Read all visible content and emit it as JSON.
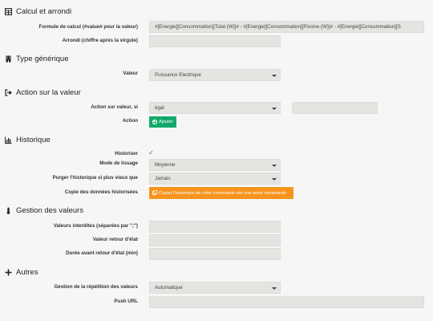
{
  "sections": {
    "calcul": "Calcul et arrondi",
    "type": "Type générique",
    "action": "Action sur la valeur",
    "historique": "Historique",
    "gestion": "Gestion des valeurs",
    "autres": "Autres"
  },
  "calcul": {
    "formula_label": "Formule de calcul (#value# pour la valeur)",
    "formula_value": "#[Energie][Consommation][Total (W)]# - #[Energie][Consommation][Piscine (W)]# - #[Energie][Consommation][S",
    "round_label": "Arrondi (chiffre après la virgule)",
    "round_value": ""
  },
  "type": {
    "valeur_label": "Valeur",
    "valeur_selected": "Puissance Electrique"
  },
  "action": {
    "condition_label": "Action sur valeur, si",
    "condition_selected": "égal",
    "condition_value": "",
    "action_label": "Action",
    "add_button": "Ajouter"
  },
  "historique": {
    "historiser_label": "Historiser",
    "historiser_checked": "✓",
    "lissage_label": "Mode de lissage",
    "lissage_selected": "Moyenne",
    "purge_label": "Purger l'historique si plus vieux que",
    "purge_selected": "Jamais",
    "copy_label": "Copie des données historisées",
    "copy_button": "Copier l'historique de cette commande sur une autre commande"
  },
  "gestion": {
    "interdites_label": "Valeurs interdites (séparées par \";\")",
    "interdites_value": "",
    "retour_label": "Valeur retour d'état",
    "retour_value": "",
    "duree_label": "Durée avant retour d'état (min)",
    "duree_value": ""
  },
  "autres": {
    "repetition_label": "Gestion de la répétition des valeurs",
    "repetition_selected": "Automatique",
    "push_label": "Push URL",
    "push_value": ""
  },
  "colors": {
    "green": "#14a86a",
    "orange": "#f7941d",
    "field": "#e4e4e1",
    "background": "#f6f6f6"
  }
}
